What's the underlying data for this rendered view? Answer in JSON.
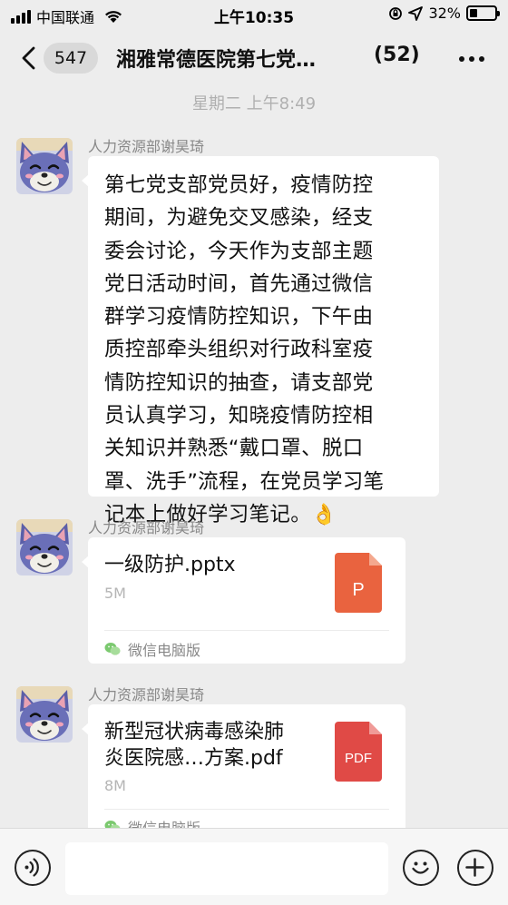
{
  "status_bar": {
    "carrier": "中国联通",
    "time": "上午10:35",
    "battery": "32%",
    "battery_level": 0.32
  },
  "nav": {
    "unread_count": "547",
    "title": "湘雅常德医院第七党…",
    "member_count": "(52)"
  },
  "chat": {
    "timestamp": "星期二 上午8:49",
    "messages": [
      {
        "sender": "人力资源部谢昊琦",
        "lines": [
          "第七党支部党员好，疫情防控",
          "期间，为避免交叉感染，经支",
          "委会讨论，今天作为支部主题",
          "党日活动时间，首先通过微信",
          "群学习疫情防控知识，下午由",
          "质控部牵头组织对行政科室疫",
          "情防控知识的抽查，请支部党",
          "员认真学习，知晓疫情防控相",
          "关知识并熟悉“戴口罩、脱口",
          "罩、洗手”流程，在党员学习笔",
          "记本上做好学习笔记。"
        ],
        "emoji": "👌"
      },
      {
        "sender": "人力资源部谢昊琦",
        "file_name": "一级防护.pptx",
        "file_size": "5M",
        "file_icon_label": "P",
        "file_icon_color": "#e9633f",
        "source": "微信电脑版"
      },
      {
        "sender": "人力资源部谢昊琦",
        "file_name": "新型冠状病毒感染肺炎医院感…方案.pdf",
        "file_name_line1": "新型冠状病毒感染肺",
        "file_name_line2": "炎医院感…方案.pdf",
        "file_size": "8M",
        "file_icon_label": "PDF",
        "file_icon_color": "#e04a46",
        "source": "微信电脑版"
      }
    ]
  },
  "input_bar": {
    "placeholder": ""
  },
  "icons": {
    "back": "chevron-left-icon",
    "more": "more-dots-icon",
    "voice": "voice-icon",
    "emoji": "emoji-icon",
    "plus": "plus-icon",
    "wechat": "wechat-logo-icon"
  }
}
